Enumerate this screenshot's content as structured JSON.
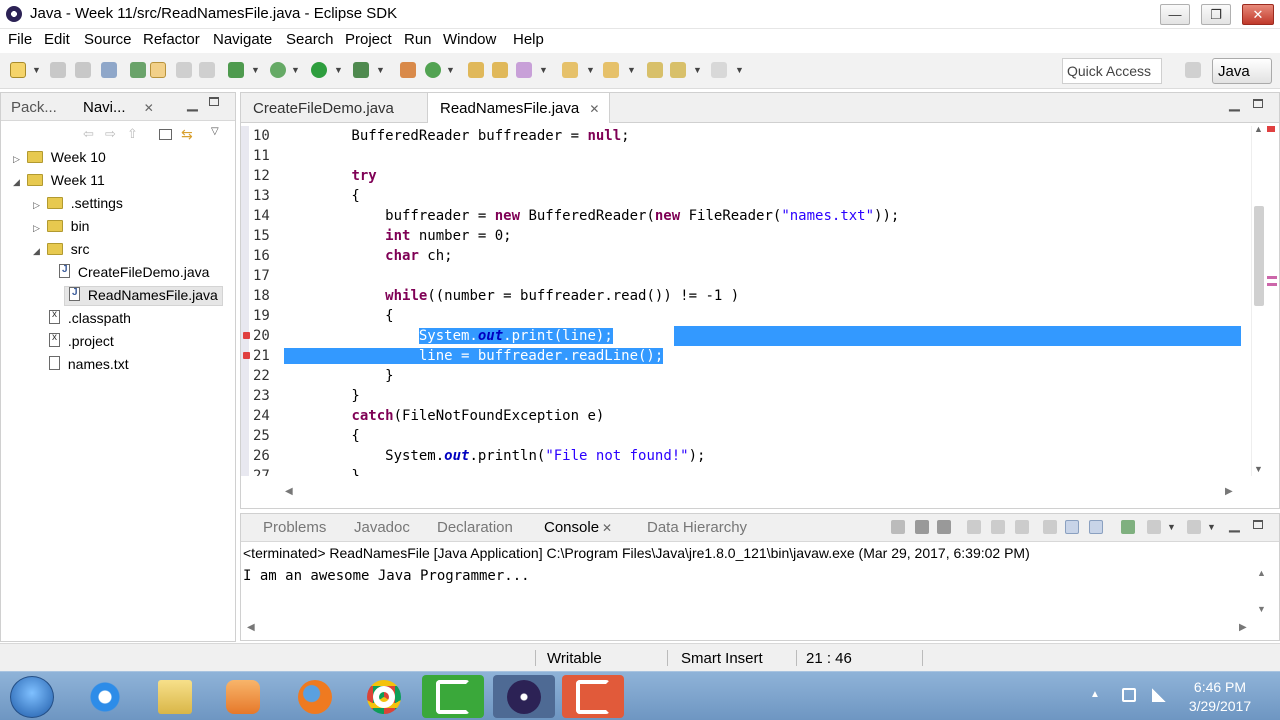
{
  "window": {
    "title": "Java - Week 11/src/ReadNamesFile.java - Eclipse SDK",
    "minimize": "—",
    "maximize": "❐",
    "close": "✕"
  },
  "menu": [
    "File",
    "Edit",
    "Source",
    "Refactor",
    "Navigate",
    "Search",
    "Project",
    "Run",
    "Window",
    "Help"
  ],
  "toolbar": {
    "quick_access": "Quick Access",
    "perspective": "Java"
  },
  "left_panel": {
    "tabs": [
      {
        "label": "Pack..."
      },
      {
        "label": "Navi...",
        "close": "✕"
      }
    ],
    "tree": [
      {
        "label": "Week 10",
        "twisty": "▷",
        "type": "proj"
      },
      {
        "label": "Week 11",
        "twisty": "◢",
        "type": "proj"
      },
      {
        "label": ".settings",
        "twisty": "▷",
        "type": "folder"
      },
      {
        "label": "bin",
        "twisty": "▷",
        "type": "folder"
      },
      {
        "label": "src",
        "twisty": "◢",
        "type": "folder"
      },
      {
        "label": "CreateFileDemo.java",
        "twisty": "",
        "type": "java"
      },
      {
        "label": "ReadNamesFile.java",
        "twisty": "",
        "type": "java"
      },
      {
        "label": ".classpath",
        "twisty": "",
        "type": "x"
      },
      {
        "label": ".project",
        "twisty": "",
        "type": "x"
      },
      {
        "label": "names.txt",
        "twisty": "",
        "type": "txt"
      }
    ]
  },
  "editor": {
    "tabs": [
      {
        "label": "CreateFileDemo.java"
      },
      {
        "label": "ReadNamesFile.java",
        "close": "✕"
      }
    ],
    "lines": [
      {
        "n": "10",
        "indent": "        ",
        "code": "BufferedReader buffreader = null;"
      },
      {
        "n": "11",
        "indent": "",
        "code": ""
      },
      {
        "n": "12",
        "indent": "        ",
        "code": "try"
      },
      {
        "n": "13",
        "indent": "        ",
        "code": "{"
      },
      {
        "n": "14",
        "indent": "            ",
        "code": "buffreader = new BufferedReader(new FileReader(\"names.txt\"));"
      },
      {
        "n": "15",
        "indent": "            ",
        "code": "int number = 0;"
      },
      {
        "n": "16",
        "indent": "            ",
        "code": "char ch;"
      },
      {
        "n": "17",
        "indent": "",
        "code": ""
      },
      {
        "n": "18",
        "indent": "            ",
        "code": "while((number = buffreader.read()) != -1 )"
      },
      {
        "n": "19",
        "indent": "            ",
        "code": "{"
      },
      {
        "n": "20",
        "indent": "                ",
        "code": "System.out.print(line);"
      },
      {
        "n": "21",
        "indent": "                ",
        "code": "line = buffreader.readLine();"
      },
      {
        "n": "22",
        "indent": "            ",
        "code": "}"
      },
      {
        "n": "23",
        "indent": "        ",
        "code": "}"
      },
      {
        "n": "24",
        "indent": "        ",
        "code": "catch(FileNotFoundException e)"
      },
      {
        "n": "25",
        "indent": "        ",
        "code": "{"
      },
      {
        "n": "26",
        "indent": "            ",
        "code": "System.out.println(\"File not found!\");"
      },
      {
        "n": "27",
        "indent": "        ",
        "code": "}"
      }
    ]
  },
  "console": {
    "tabs": [
      "Problems",
      "Javadoc",
      "Declaration",
      "Console",
      "Data Hierarchy"
    ],
    "active_tab": "Console",
    "close": "✕",
    "status": "<terminated> ReadNamesFile [Java Application] C:\\Program Files\\Java\\jre1.8.0_121\\bin\\javaw.exe (Mar 29, 2017, 6:39:02 PM)",
    "output": "I am an awesome Java Programmer..."
  },
  "statusbar": {
    "writable": "Writable",
    "insert_mode": "Smart Insert",
    "position": "21 : 46"
  },
  "taskbar": {
    "time": "6:46 PM",
    "date": "3/29/2017"
  },
  "colors": {
    "selection": "#3399ff",
    "keyword": "#7f0055",
    "string": "#2a00ff"
  }
}
